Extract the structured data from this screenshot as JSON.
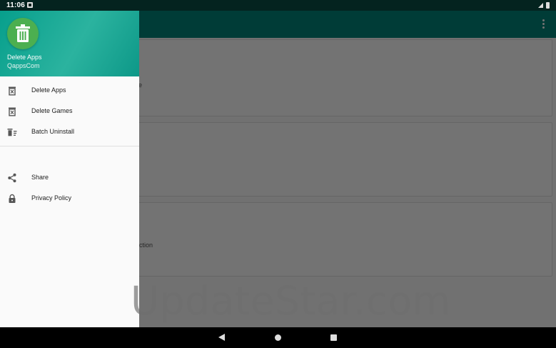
{
  "status_bar": {
    "time": "11:06"
  },
  "app_behind": {
    "card_fragments": [
      "e",
      "ction"
    ]
  },
  "drawer": {
    "app_name": "Delete Apps",
    "developer": "QappsCom",
    "menu_primary": [
      {
        "label": "Delete Apps",
        "icon": "trash-box-icon"
      },
      {
        "label": "Delete Games",
        "icon": "trash-box-icon"
      },
      {
        "label": "Batch Uninstall",
        "icon": "batch-delete-icon"
      }
    ],
    "menu_secondary": [
      {
        "label": "Share",
        "icon": "share-icon"
      },
      {
        "label": "Privacy Policy",
        "icon": "lock-icon"
      }
    ]
  },
  "watermark": "UpdateStar.com",
  "colors": {
    "app_bar": "#01867a",
    "drawer_header": "#1aa895",
    "app_icon": "#4caf50"
  }
}
